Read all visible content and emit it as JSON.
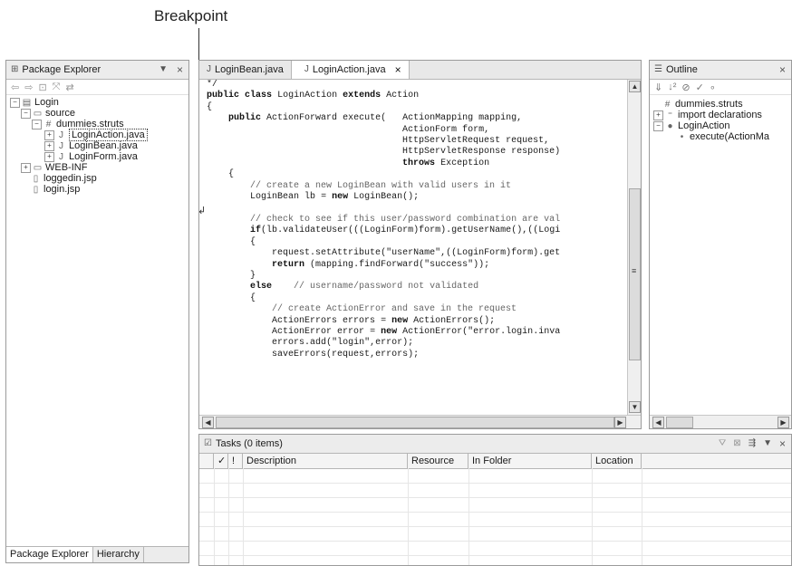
{
  "callout": {
    "label": "Breakpoint"
  },
  "package_explorer": {
    "title": "Package Explorer",
    "tree": [
      {
        "label": "Login",
        "icon": "project-icon"
      },
      {
        "label": "source",
        "icon": "folder-icon"
      },
      {
        "label": "dummies.struts",
        "icon": "package-icon"
      },
      {
        "label": "LoginAction.java",
        "icon": "java-file-icon"
      },
      {
        "label": "LoginBean.java",
        "icon": "java-file-icon"
      },
      {
        "label": "LoginForm.java",
        "icon": "java-file-icon"
      },
      {
        "label": "WEB-INF",
        "icon": "folder-icon"
      },
      {
        "label": "loggedin.jsp",
        "icon": "file-icon"
      },
      {
        "label": "login.jsp",
        "icon": "file-icon"
      }
    ],
    "bottom_tabs": [
      "Package Explorer",
      "Hierarchy"
    ]
  },
  "editor": {
    "tabs": [
      {
        "label": "LoginBean.java"
      },
      {
        "label": "LoginAction.java"
      }
    ],
    "code_lines": [
      "*/",
      "public class LoginAction extends Action",
      "{",
      "    public ActionForward execute(   ActionMapping mapping,",
      "                                    ActionForm form,",
      "                                    HttpServletRequest request,",
      "                                    HttpServletResponse response)",
      "                                    throws Exception",
      "    {",
      "        // create a new LoginBean with valid users in it",
      "        LoginBean lb = new LoginBean();",
      "",
      "        // check to see if this user/password combination are val",
      "        if(lb.validateUser(((LoginForm)form).getUserName(),((Logi",
      "        {",
      "            request.setAttribute(\"userName\",((LoginForm)form).get",
      "            return (mapping.findForward(\"success\"));",
      "        }",
      "        else    // username/password not validated",
      "        {",
      "            // create ActionError and save in the request",
      "            ActionErrors errors = new ActionErrors();",
      "            ActionError error = new ActionError(\"error.login.inva",
      "            errors.add(\"login\",error);",
      "            saveErrors(request,errors);"
    ]
  },
  "outline": {
    "title": "Outline",
    "items": [
      {
        "label": "dummies.struts",
        "icon": "package-icon"
      },
      {
        "label": "import declarations",
        "icon": "imports-icon"
      },
      {
        "label": "LoginAction",
        "icon": "class-icon"
      },
      {
        "label": "execute(ActionMa",
        "icon": "method-icon"
      }
    ]
  },
  "tasks": {
    "title": "Tasks (0 items)",
    "columns": [
      "✓",
      "!",
      "Description",
      "Resource",
      "In Folder",
      "Location"
    ]
  }
}
